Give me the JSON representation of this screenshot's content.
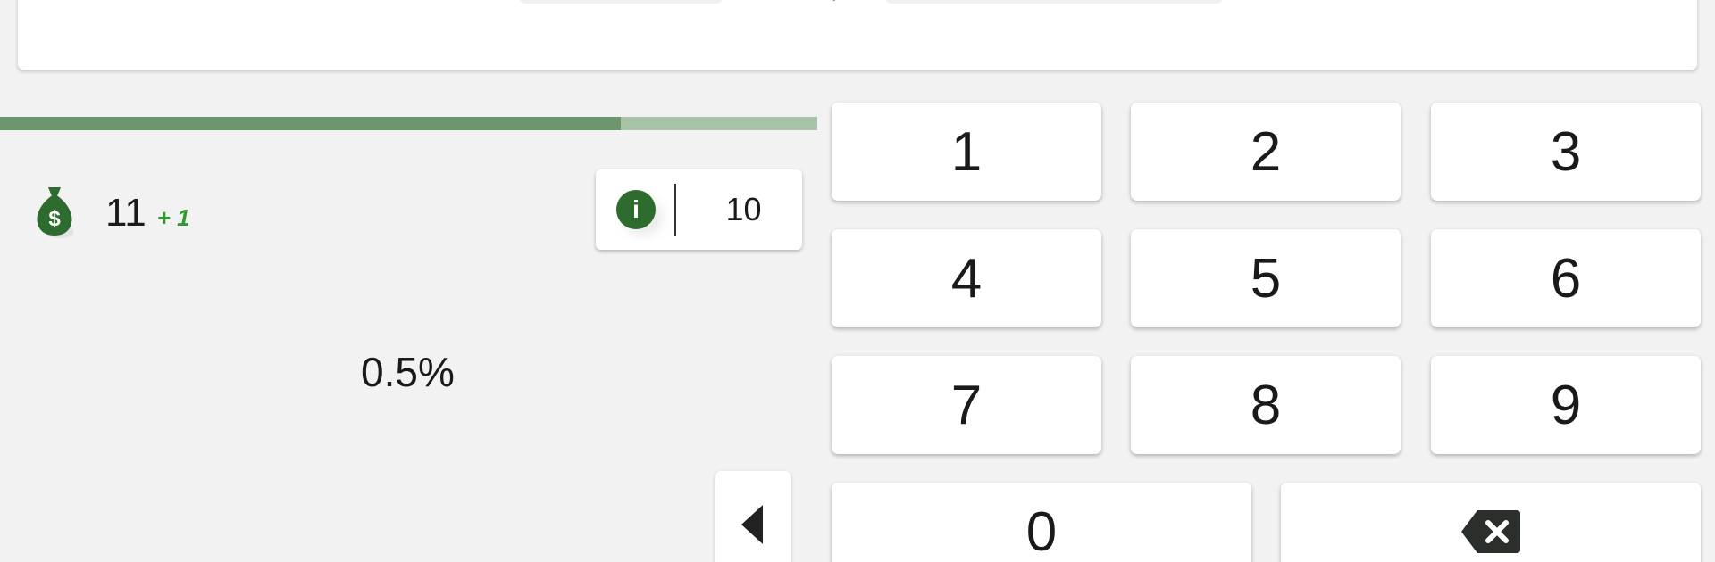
{
  "question": {
    "arrow": "→"
  },
  "progress": {
    "fraction": 0.76
  },
  "coins": {
    "count": "11",
    "bonus": "+ 1",
    "icon": "money-bag-icon",
    "icon_symbol": "$"
  },
  "info": {
    "icon": "info-icon",
    "icon_glyph": "i",
    "value": "10"
  },
  "stats": {
    "percent": "0.5%"
  },
  "keypad": {
    "keys": [
      "1",
      "2",
      "3",
      "4",
      "5",
      "6",
      "7",
      "8",
      "9",
      "0"
    ],
    "backspace_icon": "backspace-icon",
    "back_icon": "triangle-left-icon"
  },
  "colors": {
    "accent_dark": "#2e6b2e",
    "progress_fill": "#6c976c",
    "progress_track": "#a9c3a9",
    "bonus": "#2f9a2f",
    "background": "#f2f2f2"
  }
}
